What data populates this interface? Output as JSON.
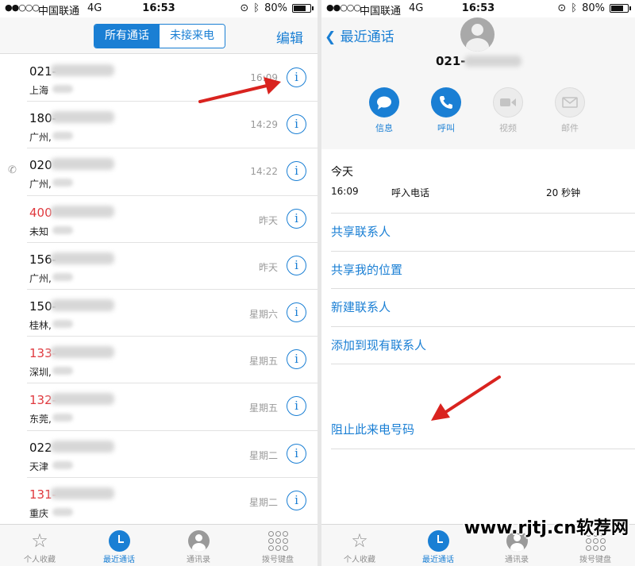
{
  "status_bar": {
    "carrier": "中国联通",
    "network": "4G",
    "time": "16:53",
    "battery": "80%",
    "battery_level": 0.8
  },
  "left": {
    "tabs": [
      "所有通话",
      "未接来电"
    ],
    "edit_label": "编辑",
    "calls": [
      {
        "number": "021-",
        "location": "上海",
        "time": "16:09",
        "missed": false,
        "outgoing": false
      },
      {
        "number": "180-",
        "location": "广州,",
        "time": "14:29",
        "missed": false,
        "outgoing": false
      },
      {
        "number": "020",
        "location": "广州,",
        "time": "14:22",
        "missed": false,
        "outgoing": true
      },
      {
        "number": "400",
        "location": "未知",
        "time": "昨天",
        "missed": true,
        "outgoing": false
      },
      {
        "number": "156-",
        "location": "广州,",
        "time": "昨天",
        "missed": false,
        "outgoing": false
      },
      {
        "number": "150-",
        "location": "桂林,",
        "time": "星期六",
        "missed": false,
        "outgoing": false
      },
      {
        "number": "133-",
        "location": "深圳,",
        "time": "星期五",
        "missed": true,
        "outgoing": false
      },
      {
        "number": "132-",
        "location": "东莞,",
        "time": "星期五",
        "missed": true,
        "outgoing": false
      },
      {
        "number": "022",
        "location": "天津",
        "time": "星期二",
        "missed": false,
        "outgoing": false
      },
      {
        "number": "131-",
        "location": "重庆",
        "time": "星期二",
        "missed": true,
        "outgoing": false
      }
    ]
  },
  "tabbar": [
    "个人收藏",
    "最近通话",
    "通讯录",
    "拨号键盘"
  ],
  "right": {
    "back_label": "最近通话",
    "contact_number": "021-",
    "actions": [
      {
        "label": "信息",
        "icon": "message-icon",
        "enabled": true
      },
      {
        "label": "呼叫",
        "icon": "phone-icon",
        "enabled": true
      },
      {
        "label": "视频",
        "icon": "video-icon",
        "enabled": false
      },
      {
        "label": "邮件",
        "icon": "mail-icon",
        "enabled": false
      }
    ],
    "history": {
      "day": "今天",
      "time": "16:09",
      "type": "呼入电话",
      "duration": "20 秒钟"
    },
    "menu": [
      "共享联系人",
      "共享我的位置",
      "新建联系人",
      "添加到现有联系人"
    ],
    "block_label": "阻止此来电号码"
  },
  "watermark": "www.rjtj.cn软荐网"
}
